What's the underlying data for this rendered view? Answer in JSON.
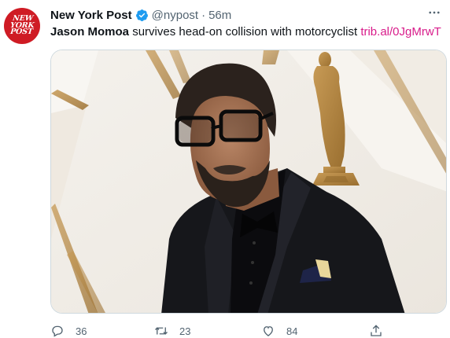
{
  "author": {
    "display_name": "New York Post",
    "handle": "@nypost",
    "separator": "·",
    "time": "56m",
    "avatar_text": [
      "NEW",
      "YORK",
      "POST"
    ]
  },
  "tweet": {
    "bold_text": "Jason Momoa",
    "text": " survives head-on collision with motorcyclist ",
    "link": "trib.al/0JgMrwT"
  },
  "actions": {
    "replies": "36",
    "retweets": "23",
    "likes": "84"
  },
  "colors": {
    "brand_red": "#cf1b24",
    "verified_blue": "#1d9bf0",
    "link_color": "#d81b8a",
    "muted_text": "#536471"
  },
  "icons": [
    "verified-badge-icon",
    "more-icon",
    "reply-icon",
    "retweet-icon",
    "like-icon",
    "share-icon"
  ]
}
